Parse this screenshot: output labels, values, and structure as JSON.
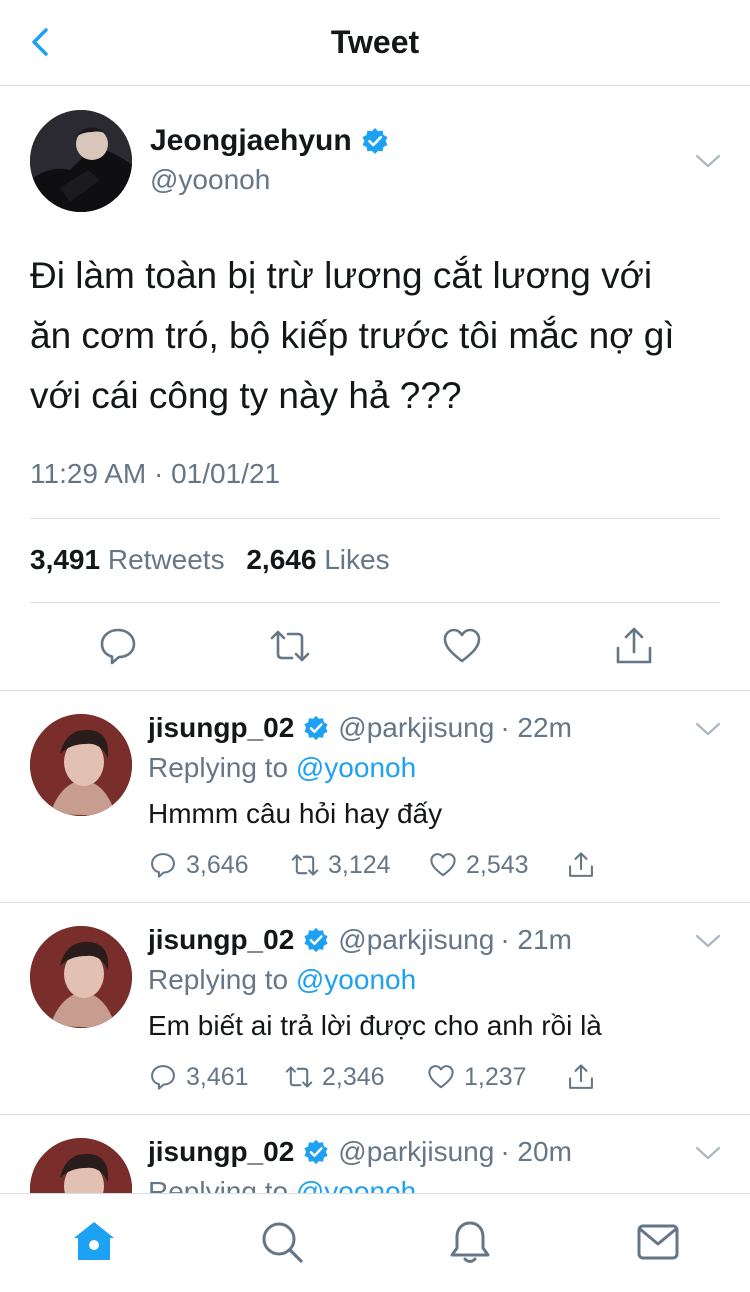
{
  "header": {
    "title": "Tweet"
  },
  "tweet": {
    "name": "Jeongjaehyun",
    "handle": "@yoonoh",
    "lines": [
      "Đi làm toàn bị trừ lương cắt lương với",
      "ăn cơm tró, bộ kiếp trước tôi mắc nợ gì",
      "với cái công ty này hả ???"
    ],
    "timestamp": "11:29 AM · 01/01/21",
    "retweets_count": "3,491",
    "retweets_label": "Retweets",
    "likes_count": "2,646",
    "likes_label": "Likes"
  },
  "replies": [
    {
      "name": "jisungp_02",
      "handle": "@parkjisung",
      "time": "· 22m",
      "replying_prefix": "Replying to ",
      "replying_to": "@yoonoh",
      "text": "Hmmm câu hỏi hay đấy",
      "reply_count": "3,646",
      "retweet_count": "3,124",
      "like_count": "2,543"
    },
    {
      "name": "jisungp_02",
      "handle": "@parkjisung",
      "time": "· 21m",
      "replying_prefix": "Replying to ",
      "replying_to": "@yoonoh",
      "text": "Em biết ai trả lời được cho anh rồi là",
      "reply_count": "3,461",
      "retweet_count": "2,346",
      "like_count": "1,237"
    },
    {
      "name": "jisungp_02",
      "handle": "@parkjisung",
      "time": "· 20m",
      "replying_prefix": "Replying to ",
      "replying_to": "@yoonoh"
    }
  ],
  "colors": {
    "accent": "#1da1f2",
    "muted": "#657786",
    "text": "#14171a",
    "divider": "#d9dde1"
  },
  "icons": [
    "back-chevron-icon",
    "verified-badge-icon",
    "chevron-down-icon",
    "reply-icon",
    "retweet-icon",
    "like-icon",
    "share-icon",
    "home-icon",
    "search-icon",
    "notifications-icon",
    "messages-icon"
  ]
}
